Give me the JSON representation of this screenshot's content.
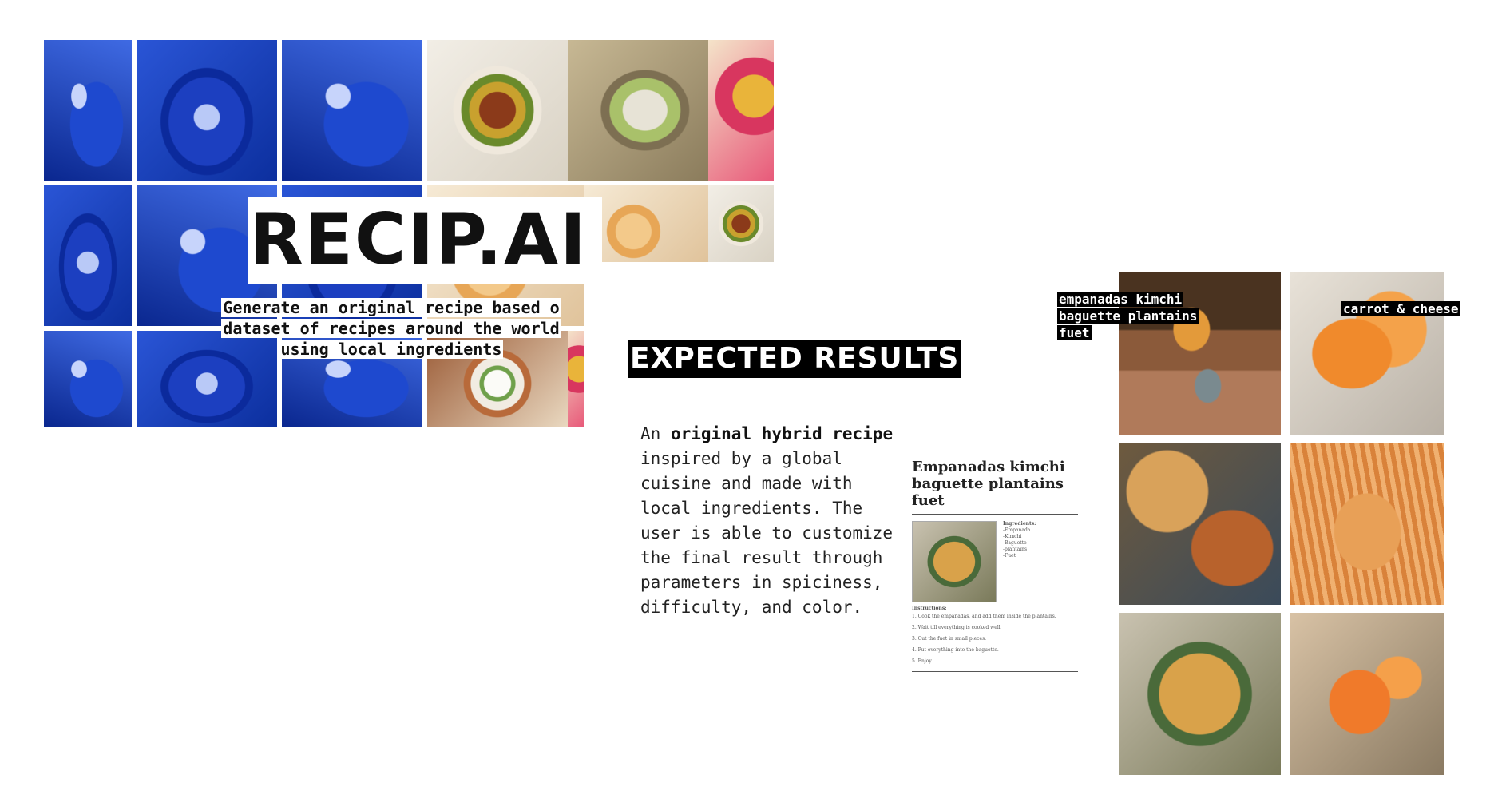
{
  "hero": {
    "title": "RECIP.AI",
    "subtitle_lines": [
      "Generate an original recipe based o",
      "dataset of recipes  around the world",
      "using local ingredients"
    ]
  },
  "results": {
    "heading": "EXPECTED RESULTS",
    "description": {
      "part1": "An ",
      "bold": "original hybrid recipe",
      "part2": " inspired by a global cuisine and made with local ingredients. The user is able to customize the final result through parameters in spiciness, difficulty, and color."
    },
    "recipe_card": {
      "title": "Empanadas kimchi baguette plantains fuet",
      "ingredients_heading": "Ingredients:",
      "ingredients": [
        "-Empanada",
        "-Kimchi",
        "-Baguette",
        "-plantains",
        "-Fuet"
      ],
      "instructions_heading": "Instructions:",
      "steps": [
        "1. Cook the empanadas, and add them inside the plantains.",
        "2. Wait till everything is cooked well.",
        "3. Cut the fuet in small pieces.",
        "4. Put everything into the baguette.",
        "5. Enjoy"
      ]
    },
    "label_left": [
      "empanadas kimchi",
      "baguette plantains",
      "fuet"
    ],
    "label_right": "carrot & cheese"
  }
}
